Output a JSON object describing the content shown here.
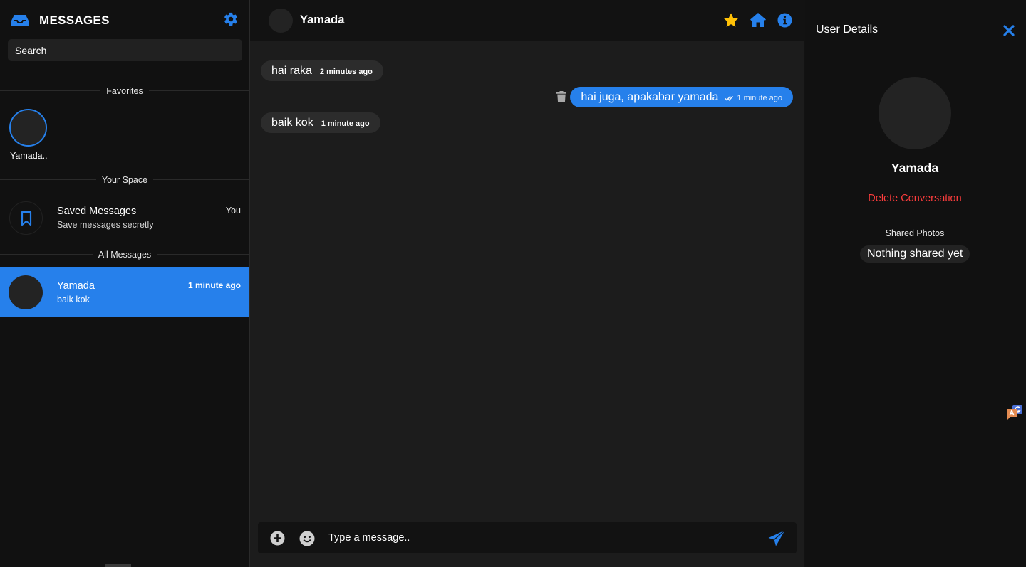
{
  "sidebar": {
    "title": "MESSAGES",
    "search_placeholder": "Search",
    "favorites_label": "Favorites",
    "favorites": [
      {
        "name": "Yamada.."
      }
    ],
    "your_space_label": "Your Space",
    "saved": {
      "name": "Saved Messages",
      "subtitle": "Save messages secretly",
      "tag": "You"
    },
    "all_messages_label": "All Messages",
    "contacts": [
      {
        "name": "Yamada",
        "last_message": "baik kok",
        "time": "1 minute ago"
      }
    ]
  },
  "chat": {
    "contact_name": "Yamada",
    "messages": [
      {
        "direction": "in",
        "text": "hai raka",
        "time": "2 minutes ago"
      },
      {
        "direction": "out",
        "text": "hai juga, apakabar yamada",
        "time": "1 minute ago",
        "seen": true
      },
      {
        "direction": "in",
        "text": "baik kok",
        "time": "1 minute ago"
      }
    ],
    "composer_placeholder": "Type a message.."
  },
  "details": {
    "title": "User Details",
    "name": "Yamada",
    "delete_label": "Delete Conversation",
    "shared_photos_label": "Shared Photos",
    "empty_label": "Nothing shared yet"
  },
  "colors": {
    "accent": "#2680eb",
    "star": "#ffc107",
    "danger": "#ff3d3d",
    "bg_main": "#1c1c1c",
    "bg_panel": "#111111"
  },
  "icons": [
    "inbox-icon",
    "gear-icon",
    "bookmark-icon",
    "star-icon",
    "home-icon",
    "info-icon",
    "trash-icon",
    "double-check-icon",
    "plus-circle-icon",
    "smiley-icon",
    "send-icon",
    "close-icon",
    "translate-icon"
  ]
}
